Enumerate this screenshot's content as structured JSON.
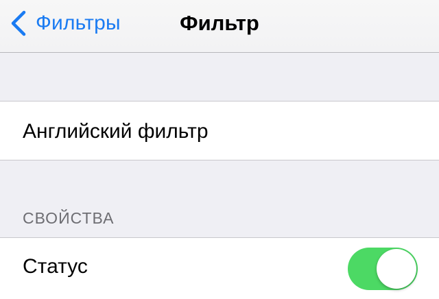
{
  "navbar": {
    "back_label": "Фильтры",
    "title": "Фильтр",
    "back_icon": "chevron-left-icon"
  },
  "filter_cell": {
    "label": "Английский фильтр"
  },
  "properties_section": {
    "header": "СВОЙСТВА",
    "status": {
      "label": "Статус",
      "enabled": true
    }
  },
  "colors": {
    "accent": "#1a7bf2",
    "toggle_on": "#4cd964",
    "background": "#efeff4"
  }
}
